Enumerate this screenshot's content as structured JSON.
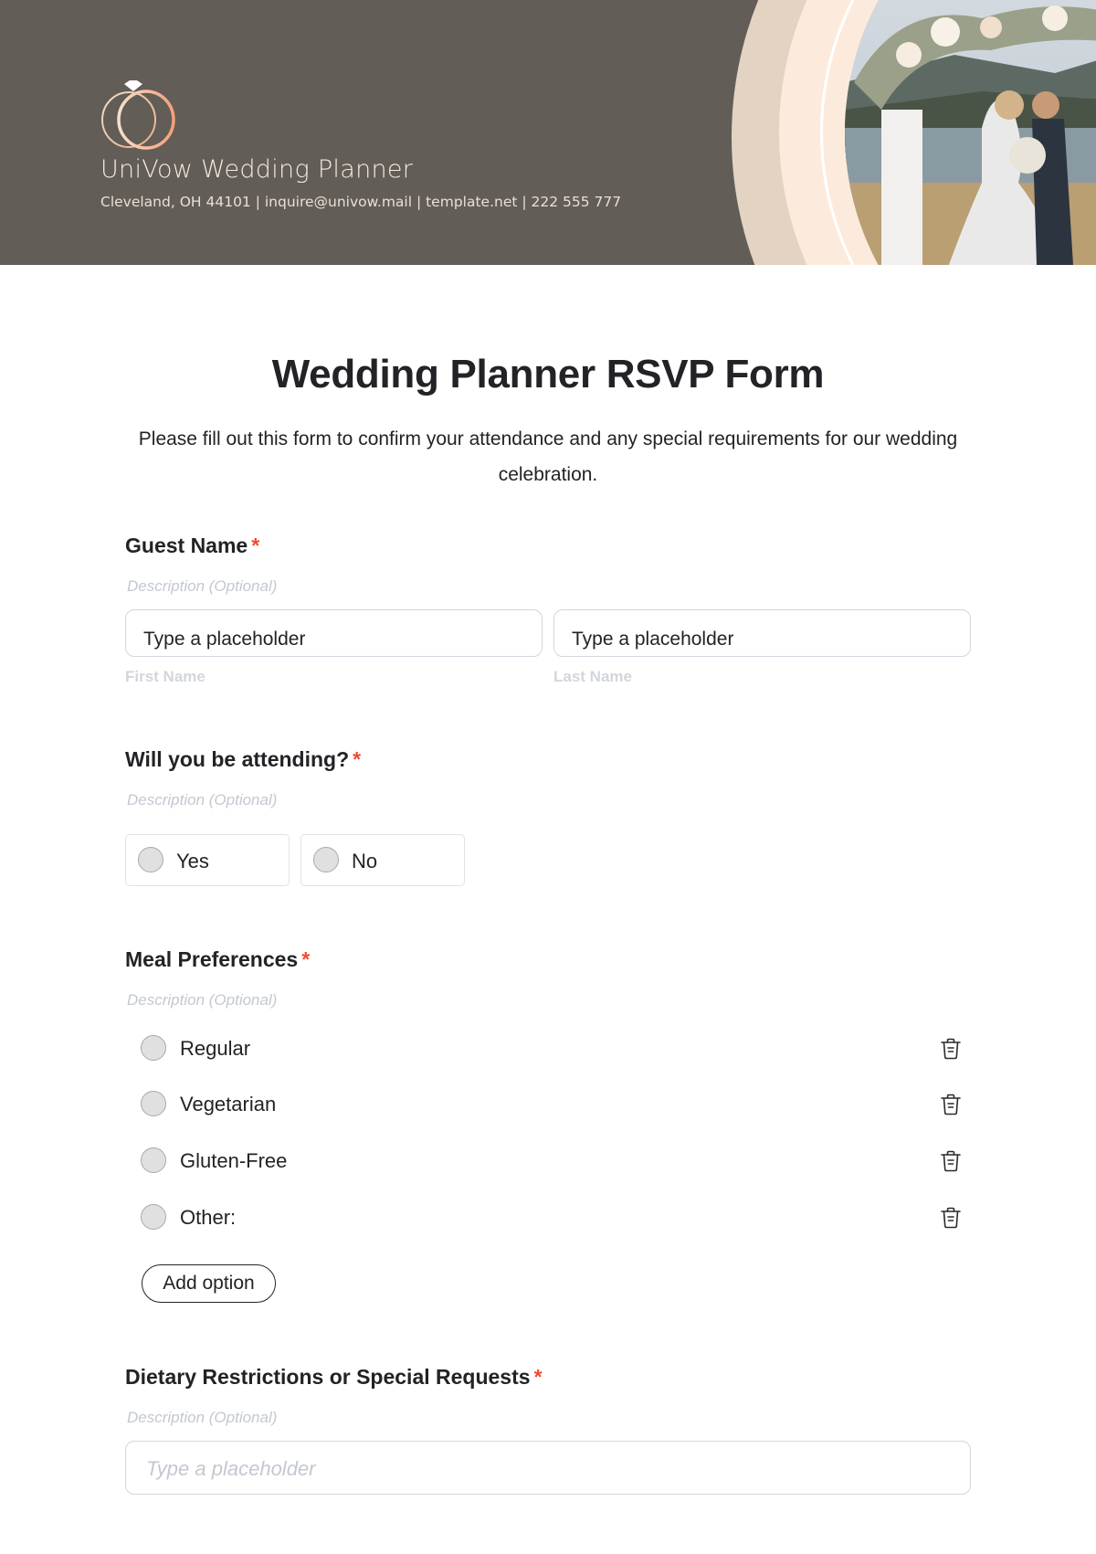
{
  "header": {
    "brand_name": "UniVow Wedding Planner",
    "contact_line": "Cleveland, OH 44101 | inquire@univow.mail | template.net | 222 555 777",
    "logo_icon": "wedding-rings-icon",
    "photo": "wedding-couple-photo",
    "colors": {
      "background": "#625d57",
      "arc_outer": "#e3d3c3",
      "arc_inner": "#fcebdc",
      "ring_accent": "#f0a784"
    }
  },
  "form": {
    "title": "Wedding Planner RSVP Form",
    "subtitle": "Please fill out this form to confirm your attendance and any special requirements for our wedding celebration.",
    "required_mark": "*",
    "accent_color": "#f04a31",
    "questions": {
      "guest_name": {
        "label": "Guest Name",
        "description": "Description (Optional)",
        "first_name": {
          "value": "Type a placeholder",
          "sublabel": "First Name"
        },
        "last_name": {
          "value": "Type a placeholder",
          "sublabel": "Last Name"
        }
      },
      "attending": {
        "label": "Will you be attending?",
        "description": "Description (Optional)",
        "options": [
          "Yes",
          "No"
        ]
      },
      "meal": {
        "label": "Meal Preferences",
        "description": "Description (Optional)",
        "options": [
          "Regular",
          "Vegetarian",
          "Gluten-Free",
          "Other:"
        ],
        "delete_icon": "trash-icon",
        "add_option_label": "Add option"
      },
      "dietary": {
        "label": "Dietary Restrictions or Special Requests",
        "description": "Description (Optional)",
        "placeholder": "Type a placeholder"
      }
    }
  }
}
